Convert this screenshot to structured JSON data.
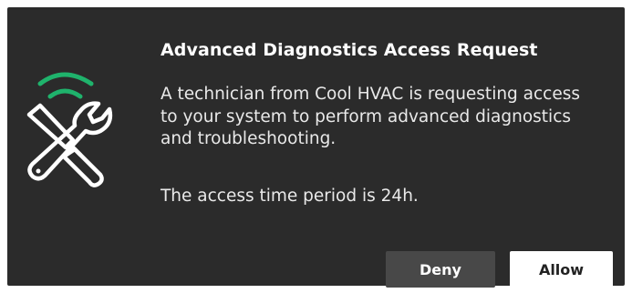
{
  "dialog": {
    "icon": "wifi-tools-icon",
    "title": "Advanced Diagnostics Access Request",
    "message": "A technician from Cool HVAC is requesting access to your system to perform advanced diagnostics and troubleshooting.",
    "period_text": "The access time period is 24h.",
    "buttons": {
      "deny_label": "Deny",
      "allow_label": "Allow"
    }
  },
  "colors": {
    "background": "#2b2b2b",
    "signal_green": "#1fb36c",
    "deny_button": "#484848",
    "allow_button": "#ffffff"
  }
}
